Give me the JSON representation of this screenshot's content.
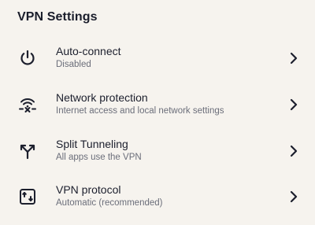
{
  "header": {
    "title": "VPN Settings"
  },
  "items": [
    {
      "title": "Auto-connect",
      "subtitle": "Disabled",
      "icon": "power-icon"
    },
    {
      "title": "Network protection",
      "subtitle": "Internet access and local network settings",
      "icon": "wifi-blocked-icon"
    },
    {
      "title": "Split Tunneling",
      "subtitle": "All apps use the VPN",
      "icon": "split-arrows-icon"
    },
    {
      "title": "VPN protocol",
      "subtitle": "Automatic (recommended)",
      "icon": "protocol-arrows-icon"
    }
  ],
  "colors": {
    "background": "#f6f3ee",
    "text_primary": "#1c1f2d",
    "text_secondary": "#6b6e7a"
  }
}
